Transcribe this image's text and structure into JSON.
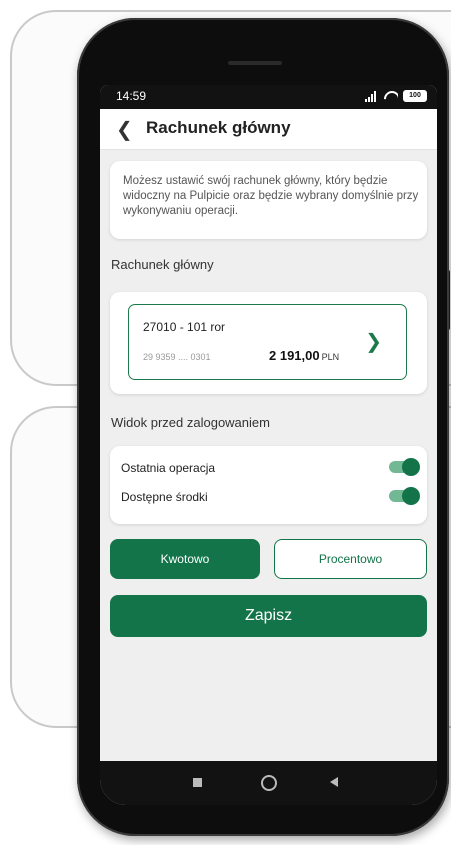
{
  "status_bar": {
    "time": "14:59",
    "battery": "100"
  },
  "header": {
    "back_icon": "chevron-left",
    "title": "Rachunek główny"
  },
  "info": {
    "text": "Możesz ustawić swój rachunek główny, który będzie widoczny na Pulpicie oraz będzie wybrany domyślnie przy wykonywaniu operacji."
  },
  "account_section": {
    "label": "Rachunek główny",
    "account": {
      "name": "27010 - 101 ror",
      "number": "29 9359 .... 0301",
      "balance": "2 191,00",
      "currency": "PLN"
    }
  },
  "view_section": {
    "label": "Widok przed zalogowaniem",
    "toggles": [
      {
        "label": "Ostatnia operacja",
        "enabled": true
      },
      {
        "label": "Dostępne środki",
        "enabled": true
      }
    ]
  },
  "display_mode": {
    "options": [
      "Kwotowo",
      "Procentowo"
    ],
    "selected": "Kwotowo"
  },
  "save_button": "Zapisz",
  "colors": {
    "accent": "#13744a",
    "toggle_track": "#73b894",
    "background": "#efefef"
  }
}
